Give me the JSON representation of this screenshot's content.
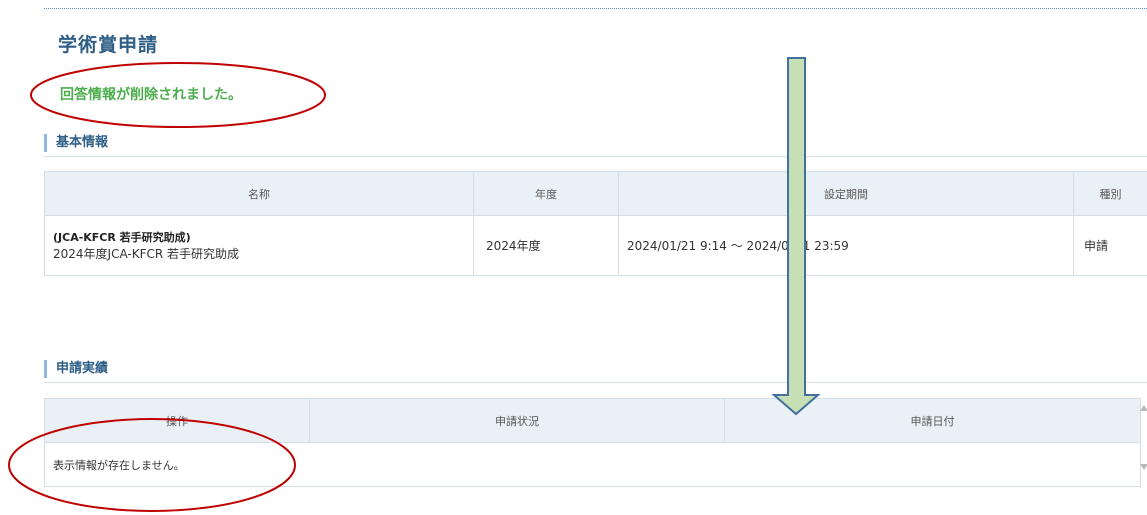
{
  "page": {
    "title": "学術賞申請",
    "success_message": "回答情報が削除されました。"
  },
  "basic_info": {
    "heading": "基本情報",
    "columns": [
      "名称",
      "年度",
      "設定期間",
      "種別"
    ],
    "row": {
      "name_bold": "(JCA-KFCR 若手研究助成)",
      "name": "2024年度JCA-KFCR 若手研究助成",
      "year": "2024年度",
      "period": "2024/01/21 9:14 ～ 2024/0",
      "period_tail": "1 23:59",
      "type": "申請"
    }
  },
  "history": {
    "heading": "申請実績",
    "columns": [
      "操作",
      "申請状況",
      "申請日付"
    ],
    "empty_message": "表示情報が存在しません。"
  },
  "annotations": {
    "ellipse_color": "#c00000",
    "arrow_fill": "#c6dfb4",
    "arrow_stroke": "#41719c"
  }
}
